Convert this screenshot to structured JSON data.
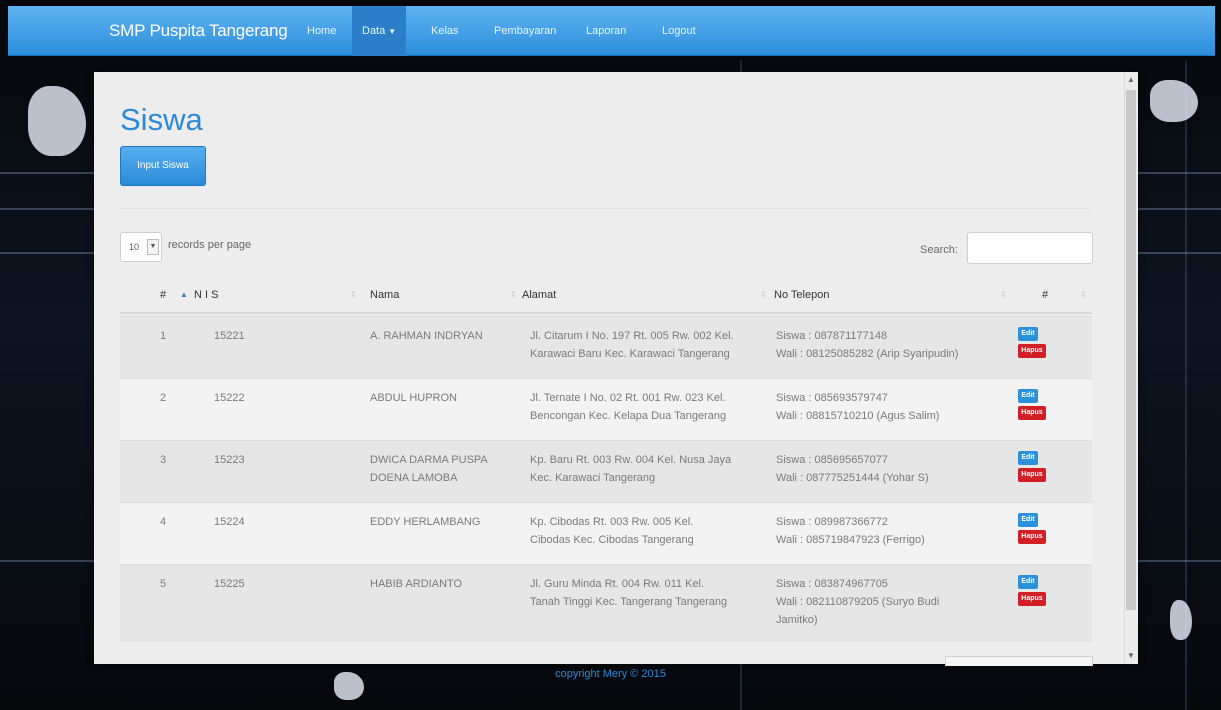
{
  "navbar": {
    "brand": "SMP Puspita Tangerang",
    "items": [
      {
        "label": "Home"
      },
      {
        "label": "Data"
      },
      {
        "label": "Kelas"
      },
      {
        "label": "Pembayaran"
      },
      {
        "label": "Laporan"
      },
      {
        "label": "Logout"
      }
    ],
    "active_item": "Data",
    "accent_color": "#2d8fdc"
  },
  "page": {
    "title": "Siswa",
    "input_button": "Input Siswa"
  },
  "datatable": {
    "page_length": "10",
    "page_length_label": "records per page",
    "search_label": "Search:",
    "search_value": "",
    "columns": [
      "#",
      "N I S",
      "Nama",
      "Alamat",
      "No Telepon",
      "#"
    ],
    "rows": [
      {
        "no": "1",
        "nis": "15221",
        "nama": "A. RAHMAN INDRYAN",
        "alamat_1": "Jl. Citarum I No. 197 Rt. 005 Rw. 002 Kel.",
        "alamat_2": "Karawaci Baru Kec. Karawaci Tangerang",
        "tel_1": "Siswa : 087871177148",
        "tel_2": "Wali : 08125085282 (Arip Syaripudin)",
        "tel_3": ""
      },
      {
        "no": "2",
        "nis": "15222",
        "nama": "ABDUL HUPRON",
        "alamat_1": "Jl. Ternate I No. 02 Rt. 001 Rw. 023 Kel.",
        "alamat_2": "Bencongan Kec. Kelapa Dua Tangerang",
        "tel_1": "Siswa : 085693579747",
        "tel_2": "Wali : 08815710210 (Agus Salim)",
        "tel_3": ""
      },
      {
        "no": "3",
        "nis": "15223",
        "nama": "DWICA DARMA PUSPA",
        "nama_2": "DOENA LAMOBA",
        "alamat_1": "Kp. Baru Rt. 003 Rw. 004 Kel. Nusa Jaya",
        "alamat_2": "Kec. Karawaci Tangerang",
        "tel_1": "Siswa : 085695657077",
        "tel_2": "Wali : 087775251444 (Yohar S)",
        "tel_3": ""
      },
      {
        "no": "4",
        "nis": "15224",
        "nama": "EDDY HERLAMBANG",
        "alamat_1": "Kp. Cibodas Rt. 003 Rw. 005 Kel.",
        "alamat_2": "Cibodas Kec. Cibodas Tangerang",
        "tel_1": "Siswa : 089987366772",
        "tel_2": "Wali : 085719847923 (Ferrigo)",
        "tel_3": ""
      },
      {
        "no": "5",
        "nis": "15225",
        "nama": "HABIB ARDIANTO",
        "alamat_1": "Jl. Guru Minda Rt. 004 Rw. 011 Kel.",
        "alamat_2": "Tanah Tinggi Kec. Tangerang Tangerang",
        "tel_1": "Siswa : 083874967705",
        "tel_2": "Wali : 082110879205 (Suryo Budi",
        "tel_3": "Jamitko)"
      }
    ],
    "edit_label": "Edit",
    "delete_label": "Hapus"
  },
  "footer": {
    "text": "copyright Mery © 2015"
  },
  "icons": {
    "dropdown": "caret-down-icon",
    "sort": "sort-icon",
    "scroll": "scrollbar"
  }
}
